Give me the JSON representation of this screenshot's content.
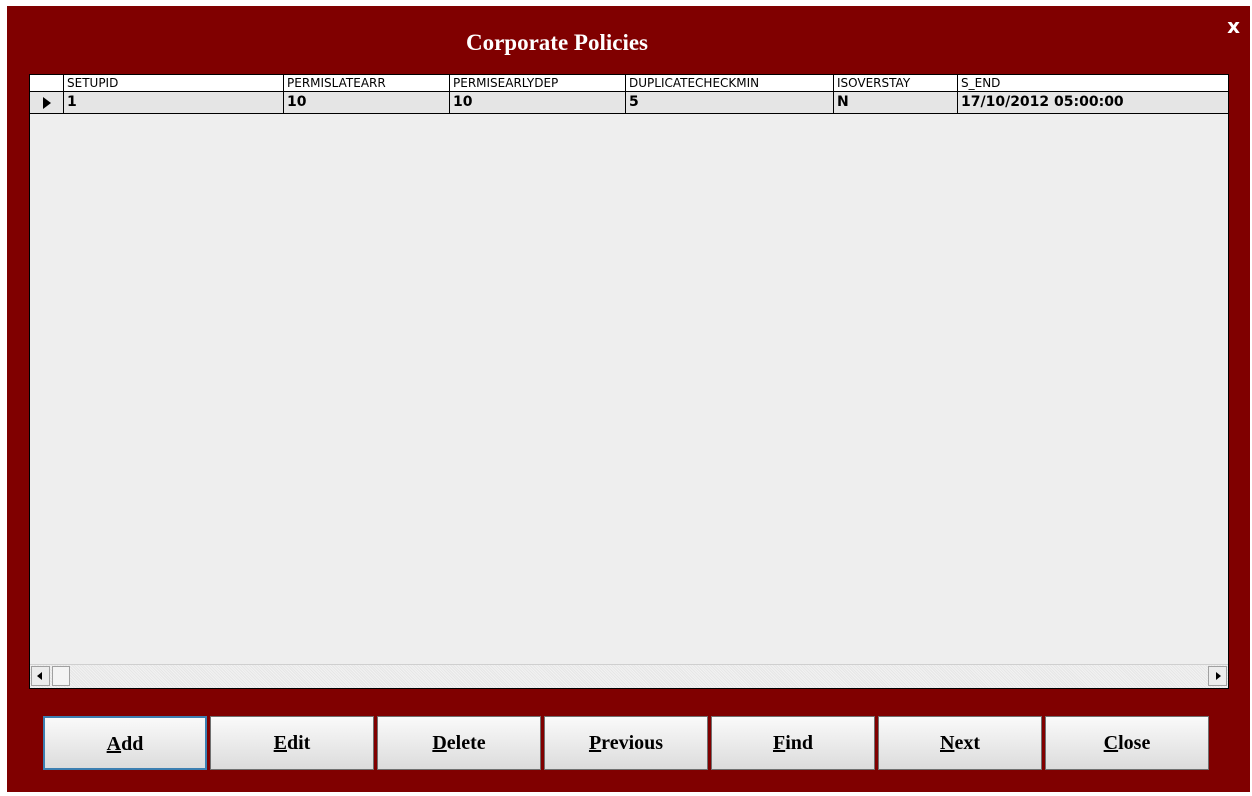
{
  "window": {
    "title": "Corporate Policies",
    "close_label": "x"
  },
  "grid": {
    "columns": [
      "SETUPID",
      "PERMISLATEARR",
      "PERMISEARLYDEP",
      "DUPLICATECHECKMIN",
      "ISOVERSTAY",
      "S_END"
    ],
    "rows": [
      [
        "1",
        "10",
        "10",
        "5",
        "N",
        "17/10/2012 05:00:00"
      ]
    ]
  },
  "buttons": [
    {
      "key": "A",
      "rest": "dd"
    },
    {
      "key": "E",
      "rest": "dit"
    },
    {
      "key": "D",
      "rest": "elete"
    },
    {
      "key": "P",
      "rest": "revious"
    },
    {
      "key": "F",
      "rest": "ind"
    },
    {
      "key": "N",
      "rest": "ext"
    },
    {
      "key": "C",
      "rest": "lose"
    }
  ],
  "colors": {
    "window_bg": "#800000",
    "title_text": "#ffffff",
    "default_button_border": "#3c7fb1"
  }
}
